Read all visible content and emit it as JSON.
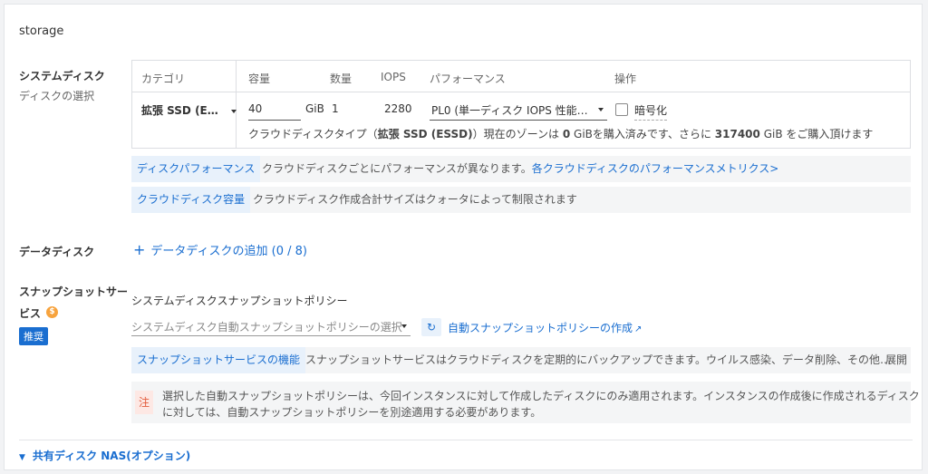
{
  "title": "storage",
  "system_disk": {
    "label": "システムディスク",
    "sublabel": "ディスクの選択",
    "columns": {
      "category": "カテゴリ",
      "capacity": "容量",
      "quantity": "数量",
      "iops": "IOPS",
      "performance": "パフォーマンス",
      "operation": "操作"
    },
    "row": {
      "category": "拡張 SSD (E…",
      "capacity_value": "40",
      "capacity_unit": "GiB",
      "quantity": "1",
      "iops": "2280",
      "performance": "PL0 (単一ディスク IOPS 性能…",
      "encrypt_label": "暗号化"
    },
    "info_line": {
      "prefix": "クラウドディスクタイプ（",
      "type": "拡張 SSD (ESSD)",
      "mid1": "）現在のゾーンは",
      "purchased": "0",
      "mid2": "GiBを購入済みです、さらに",
      "remaining": "317400",
      "suffix": "GiB をご購入頂けます"
    }
  },
  "chips": [
    {
      "tag": "ディスクパフォーマンス",
      "text": "クラウドディスクごとにパフォーマンスが異なります。",
      "link": "各クラウドディスクのパフォーマンスメトリクス>"
    },
    {
      "tag": "クラウドディスク容量",
      "text": "クラウドディスク作成合計サイズはクォータによって制限されます"
    }
  ],
  "data_disk": {
    "label": "データディスク",
    "add_icon": "plus-icon",
    "add_label": "データディスクの追加 (0 / 8)"
  },
  "snapshot": {
    "label_line1": "スナップショットサー",
    "label_line2": "ビス",
    "coin_icon": "dollar-coin-icon",
    "coin_symbol": "$",
    "badge": "推奨",
    "policy_label": "システムディスクスナップショットポリシー",
    "policy_placeholder": "システムディスク自動スナップショットポリシーの選択",
    "refresh_icon": "refresh-icon",
    "create_link": "自動スナップショットポリシーの作成",
    "external_icon": "external-link-icon",
    "feature_tag": "スナップショットサービスの機能",
    "feature_text": "スナップショットサービスはクラウドディスクを定期的にバックアップできます。ウイルス感染、データ削除、その他…",
    "expand": "展開",
    "note_mark": "注",
    "note_line1": "選択した自動スナップショットポリシーは、今回インスタンスに対して作成したディスクにのみ適用されます。インスタンスの作成後に作成されるディスク",
    "note_line2": "に対しては、自動スナップショットポリシーを別途適用する必要があります。"
  },
  "nas": {
    "label": "共有ディスク NAS(オプション)"
  },
  "colors": {
    "accent": "#1a6ed0",
    "note_red": "#e35b3c",
    "coin": "#f7a33d"
  }
}
